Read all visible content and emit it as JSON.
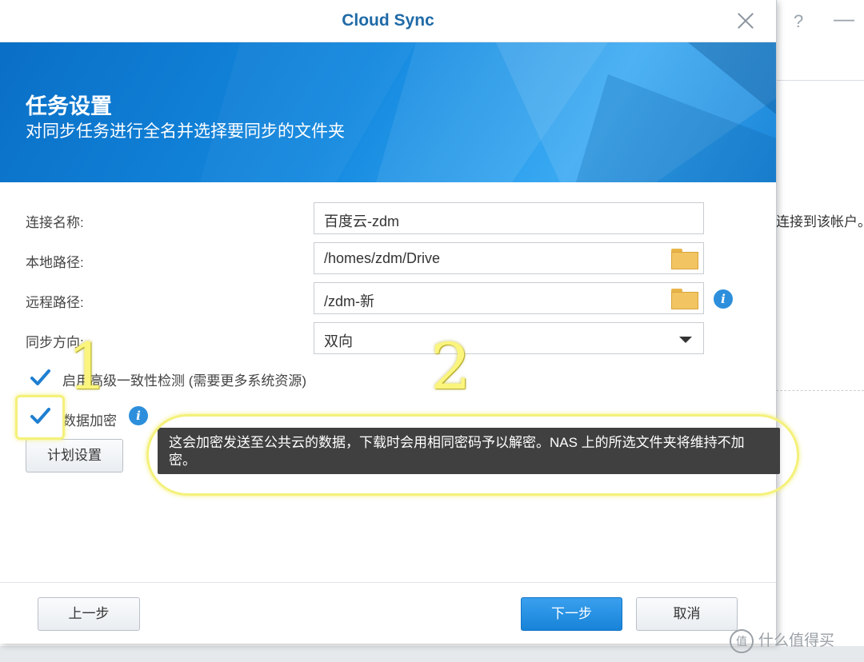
{
  "background": {
    "right_text": "连接到该帐户。",
    "help_icon": "question-mark-icon",
    "minimize_icon": "minimize-icon",
    "watermark": "什么值得买",
    "watermark_badge": "值"
  },
  "dialog": {
    "title": "Cloud Sync",
    "banner": {
      "title": "任务设置",
      "subtitle": "对同步任务进行全名并选择要同步的文件夹"
    },
    "fields": {
      "connection_name": {
        "label": "连接名称:",
        "value": "百度云-zdm"
      },
      "local_path": {
        "label": "本地路径:",
        "value": "/homes/zdm/Drive"
      },
      "remote_path": {
        "label": "远程路径:",
        "value": "/zdm-新"
      },
      "sync_direction": {
        "label": "同步方向:",
        "value": "双向"
      }
    },
    "checkboxes": {
      "advanced_consistency": {
        "label": "启用高级一致性检测 (需要更多系统资源)",
        "checked": true
      },
      "data_encryption": {
        "label": "数据加密",
        "checked": true
      }
    },
    "schedule_button": "计划设置",
    "tooltip": "这会加密发送至公共云的数据，下载时会用相同密码予以解密。NAS 上的所选文件夹将维持不加密。",
    "footer": {
      "back": "上一步",
      "next": "下一步",
      "cancel": "取消"
    }
  },
  "annotations": {
    "marker_1": "1",
    "marker_2": "2",
    "color": "#f4f17a"
  },
  "colors": {
    "accent": "#1783d8",
    "title": "#1f6aa7",
    "tooltip_bg": "#404040"
  }
}
